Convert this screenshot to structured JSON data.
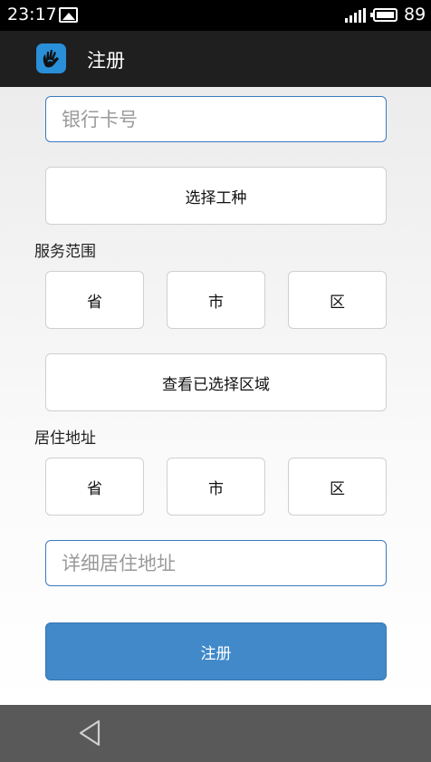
{
  "status_bar": {
    "time": "23:17",
    "battery": "89",
    "icons": [
      "image-icon",
      "signal-icon",
      "battery-icon"
    ]
  },
  "action_bar": {
    "title": "注册",
    "app_icon": "hand-logo-icon",
    "accent": "#2a8fd9"
  },
  "form": {
    "bank_card": {
      "placeholder": "银行卡号",
      "value": ""
    },
    "job_type_button": "选择工种",
    "service_area": {
      "label": "服务范围",
      "province": "省",
      "city": "市",
      "district": "区",
      "view_selected_button": "查看已选择区域"
    },
    "residence": {
      "label": "居住地址",
      "province": "省",
      "city": "市",
      "district": "区"
    },
    "address_detail": {
      "placeholder": "详细居住地址",
      "value": ""
    },
    "submit_button": "注册"
  },
  "colors": {
    "primary": "#4189c9",
    "input_border": "#3a7bbf",
    "nav_bar": "#595959"
  },
  "nav_bar": {
    "icons": [
      "back-icon"
    ]
  }
}
